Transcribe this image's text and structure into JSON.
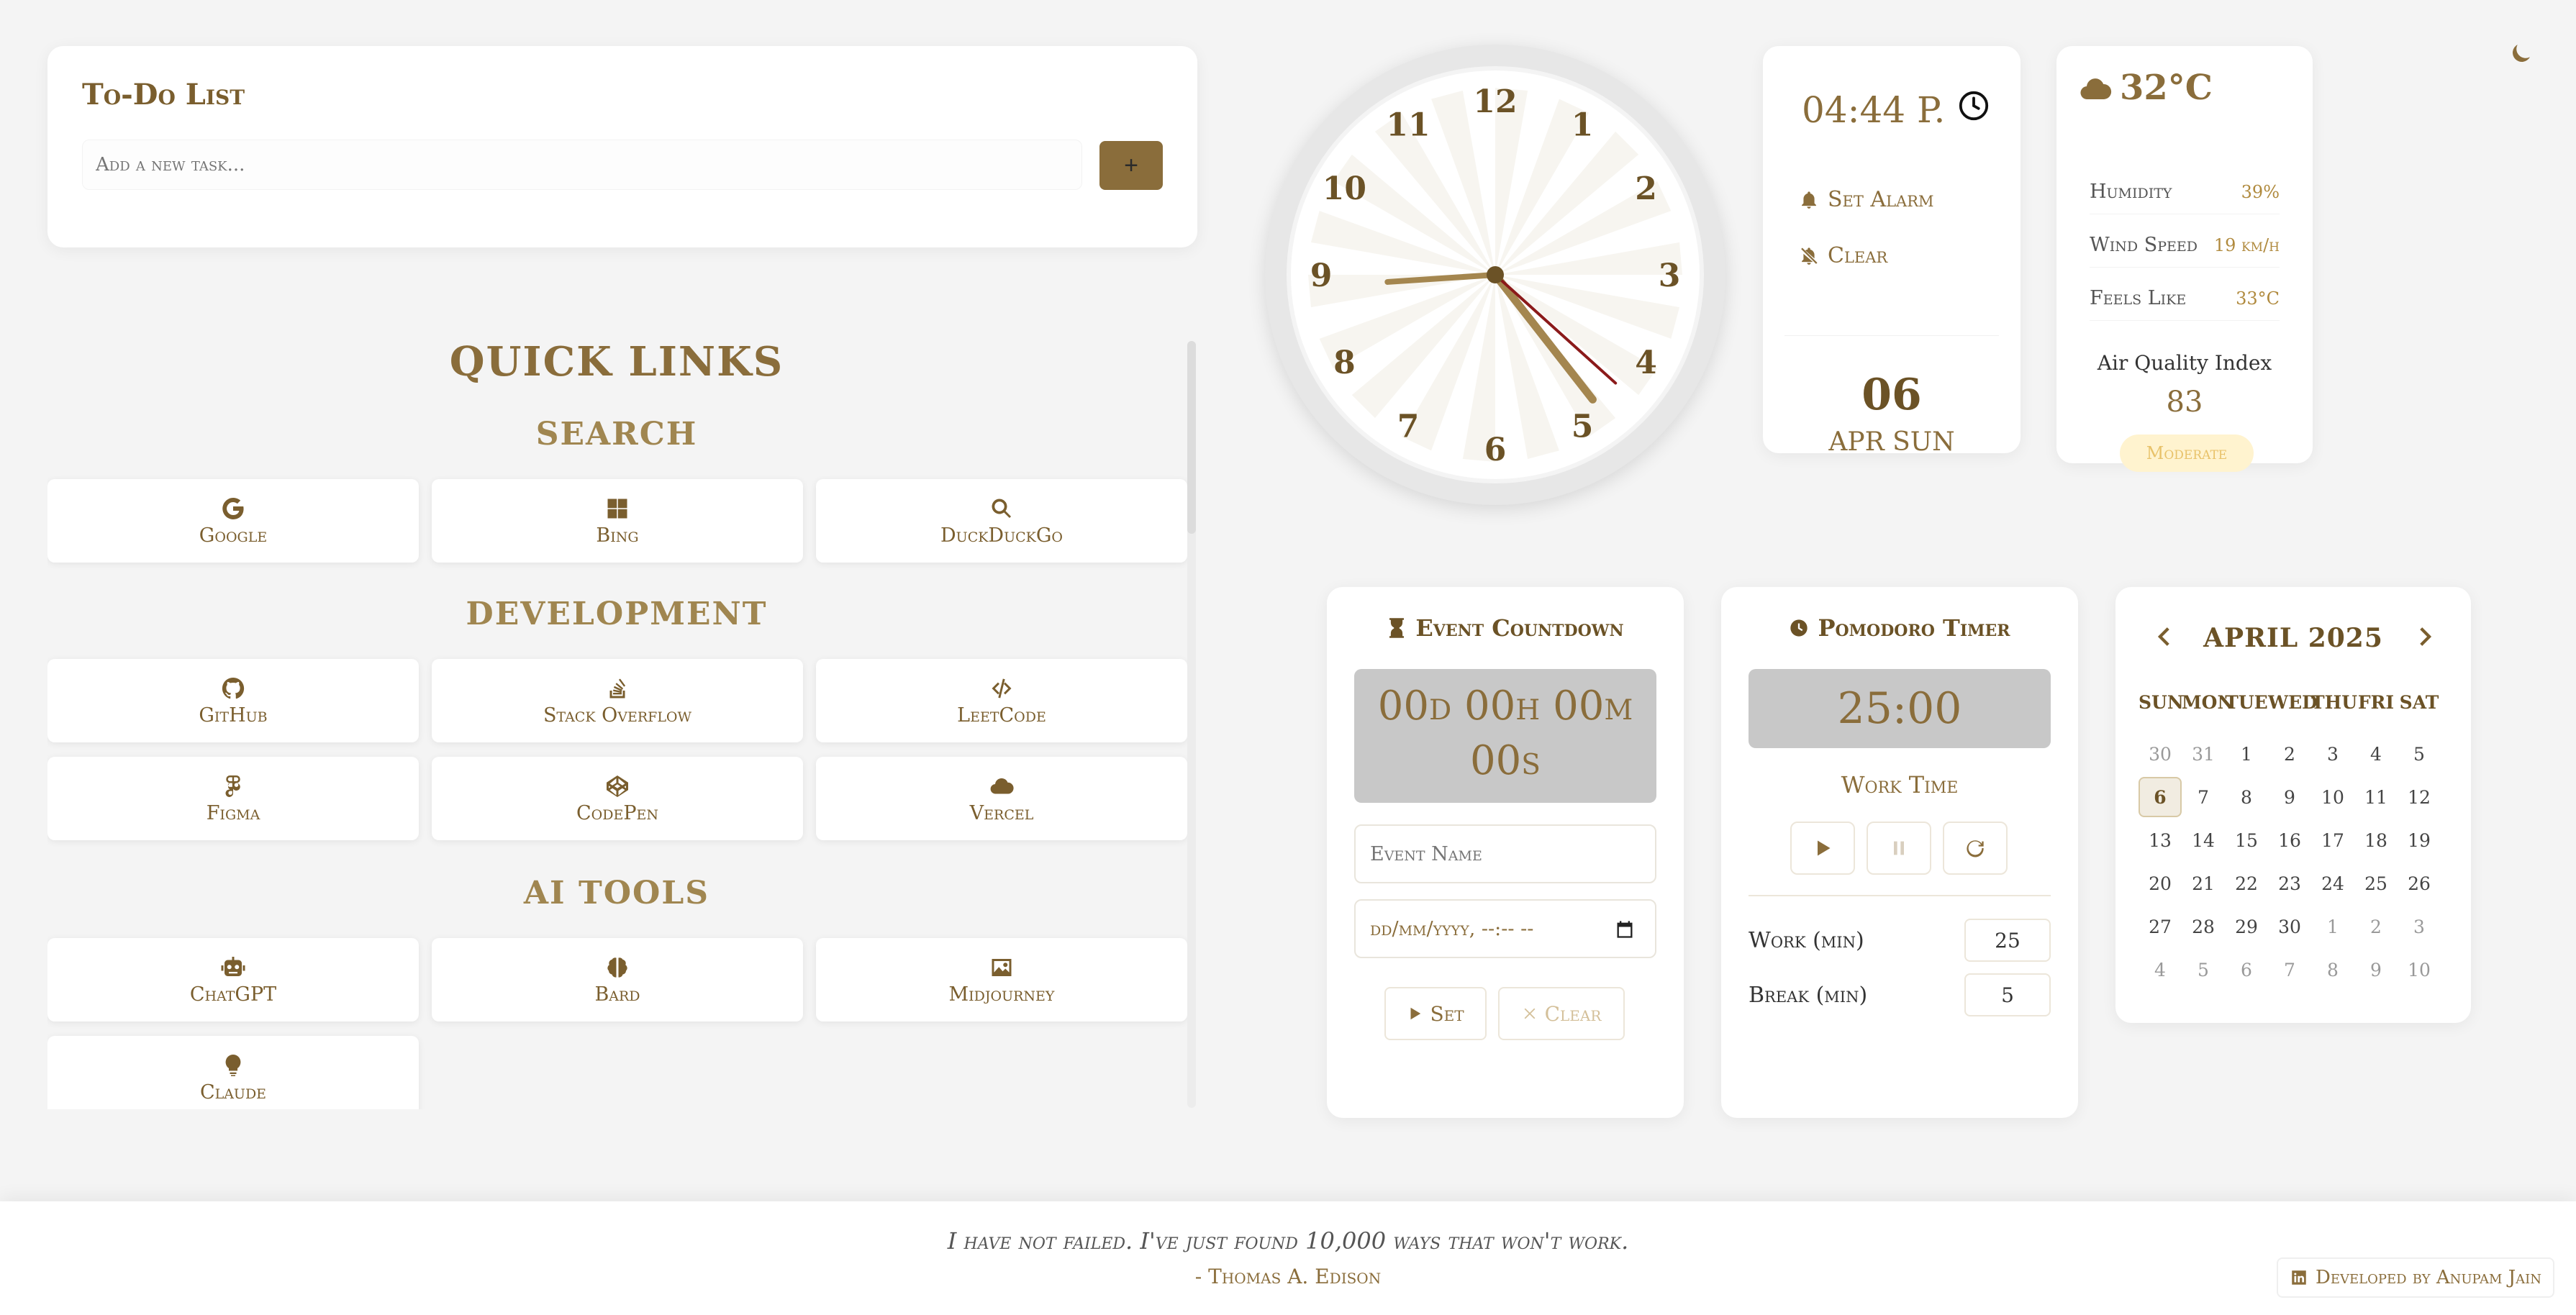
{
  "todo": {
    "title": "To-Do List",
    "placeholder": "Add a new task...",
    "add_label": "+"
  },
  "quick_links": {
    "title": "QUICK LINKS",
    "categories": [
      {
        "title": "SEARCH",
        "links": [
          {
            "label": "Google",
            "icon": "google-icon"
          },
          {
            "label": "Bing",
            "icon": "windows-icon"
          },
          {
            "label": "DuckDuckGo",
            "icon": "search-icon"
          }
        ]
      },
      {
        "title": "DEVELOPMENT",
        "links": [
          {
            "label": "GitHub",
            "icon": "github-icon"
          },
          {
            "label": "Stack Overflow",
            "icon": "stack-overflow-icon"
          },
          {
            "label": "LeetCode",
            "icon": "code-icon"
          },
          {
            "label": "Figma",
            "icon": "figma-icon"
          },
          {
            "label": "CodePen",
            "icon": "codepen-icon"
          },
          {
            "label": "Vercel",
            "icon": "cloud-icon"
          }
        ]
      },
      {
        "title": "AI TOOLS",
        "links": [
          {
            "label": "ChatGPT",
            "icon": "robot-icon"
          },
          {
            "label": "Bard",
            "icon": "brain-icon"
          },
          {
            "label": "Midjourney",
            "icon": "image-icon"
          },
          {
            "label": "Claude",
            "icon": "lightbulb-icon"
          }
        ]
      }
    ]
  },
  "analog_clock": {
    "numbers": [
      "12",
      "1",
      "2",
      "3",
      "4",
      "5",
      "6",
      "7",
      "8",
      "9",
      "10",
      "11"
    ],
    "hour": 4,
    "minute": 44,
    "second": 22
  },
  "time_card": {
    "digital_time": "04:44 P.",
    "set_alarm": "Set Alarm",
    "clear": "Clear",
    "day": "06",
    "date_text": "APR SUN"
  },
  "weather": {
    "temperature": "32°C",
    "rows": [
      {
        "label": "Humidity",
        "value": "39%"
      },
      {
        "label": "Wind Speed",
        "value": "19 km/h"
      },
      {
        "label": "Feels Like",
        "value": "33°C"
      }
    ],
    "aqi_label": "Air Quality Index",
    "aqi_value": "83",
    "aqi_status": "Moderate"
  },
  "event_countdown": {
    "title": "Event Countdown",
    "display_line1": "00d 00h 00m",
    "display_line2": "00s",
    "name_placeholder": "Event Name",
    "date_placeholder": "dd/mm/yyyy, --:-- --",
    "set_label": "Set",
    "clear_label": "Clear"
  },
  "pomodoro": {
    "title": "Pomodoro Timer",
    "time": "25:00",
    "mode": "Work Time",
    "work_label": "Work (min)",
    "work_value": "25",
    "break_label": "Break (min)",
    "break_value": "5"
  },
  "calendar": {
    "month": "APRIL 2025",
    "weekdays": [
      "SUN",
      "MON",
      "TUE",
      "WED",
      "THU",
      "FRI",
      "SAT"
    ],
    "weeks": [
      [
        "30",
        "31",
        "1",
        "2",
        "3",
        "4",
        "5"
      ],
      [
        "6",
        "7",
        "8",
        "9",
        "10",
        "11",
        "12"
      ],
      [
        "13",
        "14",
        "15",
        "16",
        "17",
        "18",
        "19"
      ],
      [
        "20",
        "21",
        "22",
        "23",
        "24",
        "25",
        "26"
      ],
      [
        "27",
        "28",
        "29",
        "30",
        "1",
        "2",
        "3"
      ],
      [
        "4",
        "5",
        "6",
        "7",
        "8",
        "9",
        "10"
      ]
    ],
    "today": "6"
  },
  "footer": {
    "quote": "I have not failed. I've just found 10,000 ways that won't work.",
    "author": "- Thomas A. Edison",
    "credit": "Developed by Anupam Jain"
  },
  "colors": {
    "accent": "#8a6d3b",
    "dark_accent": "#6b5226",
    "second_hand": "#8b1a1a",
    "badge_bg": "#fff3cf"
  }
}
